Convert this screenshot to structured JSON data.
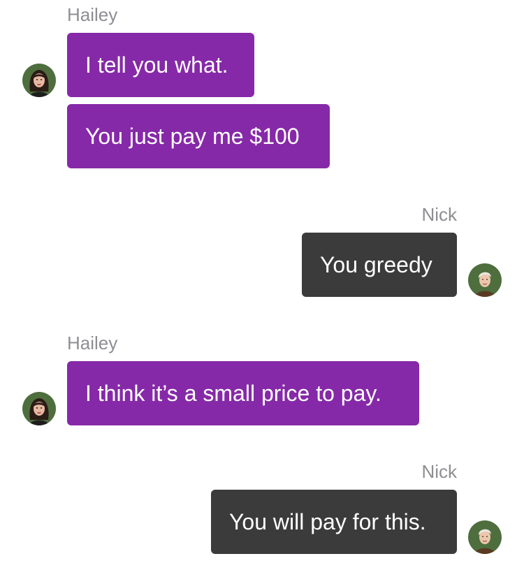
{
  "messages": [
    {
      "sender": "Hailey",
      "lines": [
        "I tell you what.",
        "You just pay me $100"
      ]
    },
    {
      "sender": "Nick",
      "lines": [
        "You greedy"
      ]
    },
    {
      "sender": "Hailey",
      "lines": [
        "I think it’s a small price to pay."
      ]
    },
    {
      "sender": "Nick",
      "lines": [
        "You will pay for this."
      ]
    }
  ],
  "colors": {
    "hailey_bubble": "#8629a8",
    "nick_bubble": "#3b3b3b",
    "sender_name": "#8e8e93",
    "avatar_background": "#4e6e3e"
  },
  "icons": {
    "hailey_avatar": "hailey-avatar-icon",
    "nick_avatar": "nick-avatar-icon"
  }
}
